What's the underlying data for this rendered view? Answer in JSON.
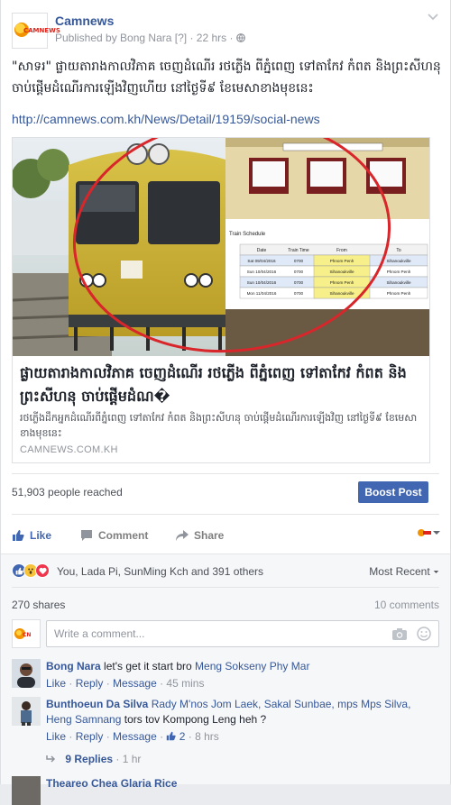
{
  "post": {
    "page_name": "Camnews",
    "logo_text": "CAMNEWS",
    "published_by": "Published by Bong Nara",
    "published_help": "[?]",
    "time": "22 hrs",
    "privacy_icon": "globe-icon",
    "text": "\"សាទរ\" ផ្លាយតារាងកាលវិភាគ ចេញដំណើរ រថភ្លើង ពីភ្នំពេញ ទៅតាកែវ កំពត និងព្រះសីហនុ ចាប់ផ្តើមដំណើរការឡើងវិញហើយ នៅថ្ងៃទី៩ ខែមេសាខាងមុខនេះ",
    "link": "http://camnews.com.kh/News/Detail/19159/social-news"
  },
  "attachment": {
    "title": "ផ្លាយតារាងកាលវិភាគ ចេញដំណើរ រថភ្លើង ពីភ្នំពេញ ទៅតាកែវ កំពត និងព្រះសីហនុ ចាប់ផ្តើមដំណ�",
    "description": "រថភ្លើងដឹកអ្នកដំណើរពីភ្នំពេញ ទៅតាកែវ កំពត និងព្រះសីហនុ ចាប់ផ្តើមដំណើរការឡើងវិញ នៅថ្ងៃទី៩ ខែមេសាខាងមុខនេះ",
    "source": "CAMNEWS.COM.KH",
    "schedule_title": "Train Schedule",
    "schedule_headers": [
      "Date",
      "Train Time",
      "From",
      "To"
    ],
    "schedule_rows": [
      [
        "Sat 09/04/2016",
        "0700",
        "Phnom Penh",
        "Sihanoukville"
      ],
      [
        "Sun 10/04/2016",
        "0700",
        "Sihanoukville",
        "Phnom Penh"
      ],
      [
        "Sun 10/04/2016",
        "0700",
        "Phnom Penh",
        "Sihanoukville"
      ],
      [
        "Mon 11/04/2016",
        "0700",
        "Sihanoukville",
        "Phnom Penh"
      ]
    ],
    "accent_color": "#d8262b"
  },
  "stats": {
    "reached": "51,903 people reached",
    "boost_label": "Boost Post"
  },
  "actions": {
    "like": "Like",
    "comment": "Comment",
    "share": "Share"
  },
  "reactions": {
    "icons": [
      "like-reaction",
      "wow-reaction",
      "love-reaction"
    ],
    "text": "You, Lada Pi, SunMing Kch and 391 others",
    "sort_label": "Most Recent",
    "shares": "270 shares",
    "comments_count": "10 comments"
  },
  "composer": {
    "placeholder": "Write a comment..."
  },
  "comments": [
    {
      "author": "Bong Nara",
      "text": "let's get it start bro",
      "tags": "Meng Sokseny Phy Mar",
      "like": "Like",
      "reply": "Reply",
      "message": "Message",
      "time": "45 mins"
    },
    {
      "author": "Bunthoeun Da Silva",
      "tags": "Rady M'nos Jom Laek, Sakal Sunbae, mps Mps Silva, Heng Samnang",
      "text": "tors tov Kompong Leng heh ?",
      "like": "Like",
      "reply": "Reply",
      "message": "Message",
      "like_count": "2",
      "time": "8 hrs",
      "replies": "9 Replies",
      "replies_time": "1 hr"
    },
    {
      "author": "Theareo Chea Glaria Rice"
    }
  ],
  "colors": {
    "facebook_blue": "#4267b2",
    "link_blue": "#365899"
  }
}
